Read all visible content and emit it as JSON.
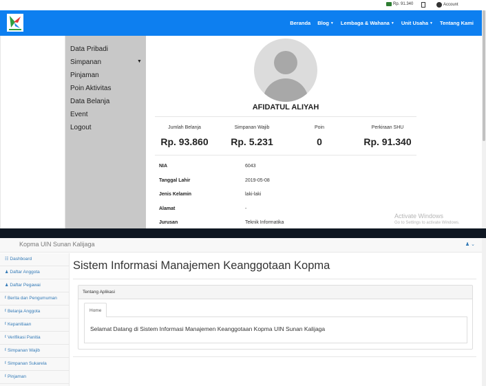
{
  "top_app": {
    "utility": {
      "balance": "Rp. 91.340",
      "account_label": "Account",
      "icons": [
        "wallet-icon",
        "document-icon",
        "user-circle-icon"
      ]
    },
    "navbar": {
      "logo_icon": "kopma-logo",
      "links": [
        {
          "label": "Beranda",
          "dropdown": false
        },
        {
          "label": "Blog",
          "dropdown": true
        },
        {
          "label": "Lembaga & Wahana",
          "dropdown": true
        },
        {
          "label": "Unit Usaha",
          "dropdown": true
        },
        {
          "label": "Tentang Kami",
          "dropdown": false
        }
      ],
      "color": "#0d7ff0"
    },
    "menu": {
      "items": [
        "Data Pribadi",
        "Simpanan",
        "Pinjaman",
        "Poin Aktivitas",
        "Data Belanja",
        "Event",
        "Logout"
      ],
      "expand_icon": "caret-down-icon"
    },
    "profile": {
      "name": "AFIDATUL ALIYAH",
      "avatar_icon": "default-user-avatar"
    },
    "stats": [
      {
        "label": "Jumlah Belanja",
        "value": "Rp. 93.860"
      },
      {
        "label": "Simpanan Wajib",
        "value": "Rp. 5.231"
      },
      {
        "label": "Poin",
        "value": "0"
      },
      {
        "label": "Perkiraan SHU",
        "value": "Rp. 91.340"
      }
    ],
    "info": [
      {
        "label": "NIA",
        "value": "6043"
      },
      {
        "label": "Tanggal Lahir",
        "value": "2019-05-08"
      },
      {
        "label": "Jenis Kelamin",
        "value": "laki-laki"
      },
      {
        "label": "Alamat",
        "value": "-"
      },
      {
        "label": "Jurusan",
        "value": "Teknik Informatika"
      }
    ],
    "watermark": {
      "title": "Activate Windows",
      "subtitle": "Go to Settings to activate Windows."
    }
  },
  "bottom_app": {
    "brand": "Kopma UIN Sunan Kalijaga",
    "header_icons": [
      "user-icon",
      "chevron-down-icon"
    ],
    "sidebar": [
      {
        "label": "Dashboard",
        "icon": "dashboard-icon"
      },
      {
        "label": "Daftar Anggota",
        "icon": "user-icon"
      },
      {
        "label": "Daftar Pegawai",
        "icon": "user-icon"
      },
      {
        "label": "Berita dan Pengumuman",
        "icon": "paperclip-icon"
      },
      {
        "label": "Belanja Anggota",
        "icon": "paperclip-icon"
      },
      {
        "label": "Kepanitiaan",
        "icon": "paperclip-icon"
      },
      {
        "label": "Verifikasi Panitia",
        "icon": "paperclip-icon"
      },
      {
        "label": "Simpanan Wajib",
        "icon": "paperclip-icon"
      },
      {
        "label": "Simpanan Sukarela",
        "icon": "paperclip-icon"
      },
      {
        "label": "Pinjaman",
        "icon": "paperclip-icon"
      }
    ],
    "title": "Sistem Informasi Manajemen Keanggotaan Kopma",
    "panel": {
      "heading": "Tentang Aplikasi",
      "tab": "Home",
      "content": "Selamat Datang di Sistem Informasi Manajemen Keanggotaan Kopma UIN Sunan Kalijaga"
    }
  }
}
